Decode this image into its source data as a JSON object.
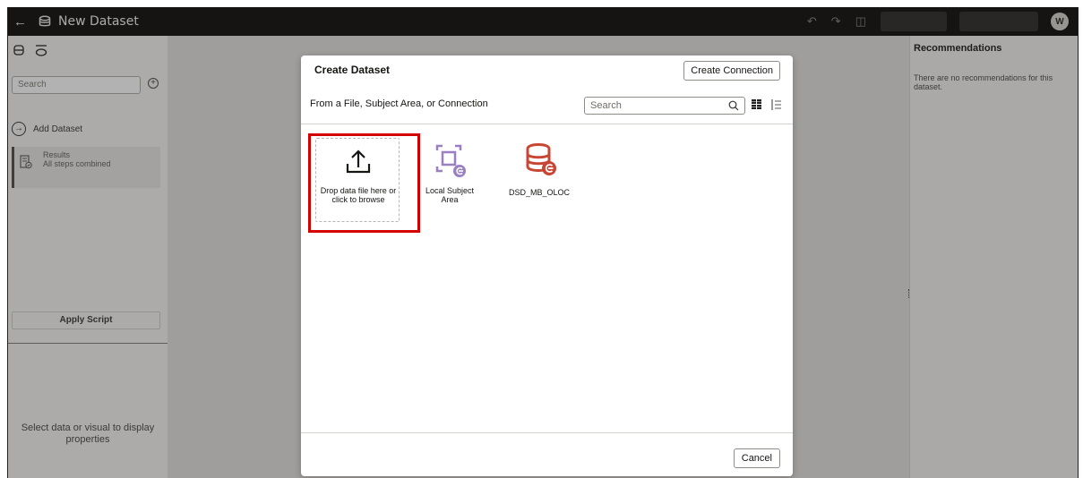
{
  "topbar": {
    "back_icon": "arrow-left-icon",
    "dataset_icon": "database-icon",
    "title": "New Dataset",
    "undo_icon": "undo-icon",
    "redo_icon": "redo-icon",
    "preview_icon": "preview-icon",
    "avatar_initial": "W"
  },
  "left_panel": {
    "search_placeholder": "Search",
    "add_dataset_label": "Add Dataset",
    "results": {
      "title": "Results",
      "subtitle": "All steps combined"
    },
    "apply_script_label": "Apply Script",
    "properties_hint": "Select data or visual to display properties"
  },
  "right_panel": {
    "title": "Recommendations",
    "message": "There are no recommendations for this dataset."
  },
  "dialog": {
    "title": "Create Dataset",
    "create_connection_label": "Create Connection",
    "subtitle": "From a File, Subject Area, or Connection",
    "search_placeholder": "Search",
    "cancel_label": "Cancel",
    "tiles": [
      {
        "label": "Drop data file here or click to browse",
        "icon": "upload-icon"
      },
      {
        "label": "Local Subject Area",
        "icon": "subject-area-icon"
      },
      {
        "label": "DSD_MB_OLOC",
        "icon": "database-connection-icon"
      }
    ]
  },
  "colors": {
    "topbar_bg": "#201e1c",
    "highlight": "#d40000",
    "subject_area": "#9a7fc2",
    "connection": "#c74634"
  }
}
